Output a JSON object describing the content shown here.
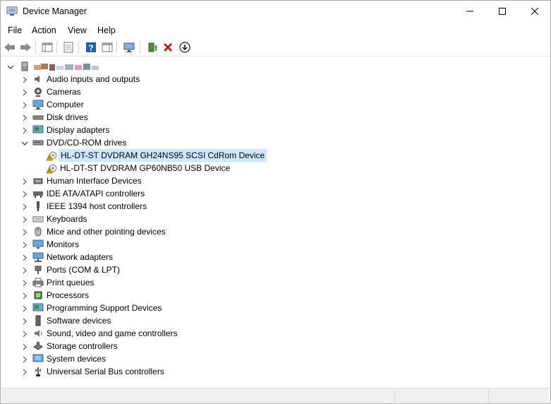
{
  "window": {
    "title": "Device Manager"
  },
  "menu": {
    "file": "File",
    "action": "Action",
    "view": "View",
    "help": "Help"
  },
  "toolbar": {
    "icons": [
      "back-arrow-icon",
      "forward-arrow-icon",
      "properties-pane-icon",
      "show-hide-tree-icon",
      "help-icon",
      "action-pane-icon",
      "scan-hardware-icon",
      "update-driver-icon",
      "uninstall-device-icon",
      "disable-device-icon"
    ],
    "colors": {
      "uninstall_red": "#d40000",
      "help_blue": "#1f5fb4"
    }
  },
  "tree": {
    "root_label": "",
    "categories": [
      {
        "label": "Audio inputs and outputs",
        "icon": "speaker-icon",
        "expanded": false
      },
      {
        "label": "Cameras",
        "icon": "camera-icon",
        "expanded": false
      },
      {
        "label": "Computer",
        "icon": "computer-icon",
        "expanded": false
      },
      {
        "label": "Disk drives",
        "icon": "disk-drive-icon",
        "expanded": false
      },
      {
        "label": "Display adapters",
        "icon": "display-adapter-icon",
        "expanded": false
      },
      {
        "label": "DVD/CD-ROM drives",
        "icon": "dvd-drive-icon",
        "expanded": true,
        "children": [
          {
            "label": "HL-DT-ST DVDRAM GH24NS95 SCSI CdRom Device",
            "icon": "warning-dvd-icon",
            "selected": true
          },
          {
            "label": "HL-DT-ST DVDRAM GP60NB50 USB Device",
            "icon": "warning-dvd-icon",
            "selected": false
          }
        ]
      },
      {
        "label": "Human Interface Devices",
        "icon": "hid-icon",
        "expanded": false
      },
      {
        "label": "IDE ATA/ATAPI controllers",
        "icon": "ide-controller-icon",
        "expanded": false
      },
      {
        "label": "IEEE 1394 host controllers",
        "icon": "firewire-icon",
        "expanded": false
      },
      {
        "label": "Keyboards",
        "icon": "keyboard-icon",
        "expanded": false
      },
      {
        "label": "Mice and other pointing devices",
        "icon": "mouse-icon",
        "expanded": false
      },
      {
        "label": "Monitors",
        "icon": "monitor-icon",
        "expanded": false
      },
      {
        "label": "Network adapters",
        "icon": "network-adapter-icon",
        "expanded": false
      },
      {
        "label": "Ports (COM & LPT)",
        "icon": "port-icon",
        "expanded": false
      },
      {
        "label": "Print queues",
        "icon": "printer-icon",
        "expanded": false
      },
      {
        "label": "Processors",
        "icon": "processor-icon",
        "expanded": false
      },
      {
        "label": "Programming Support Devices",
        "icon": "programming-device-icon",
        "expanded": false
      },
      {
        "label": "Software devices",
        "icon": "software-device-icon",
        "expanded": false
      },
      {
        "label": "Sound, video and game controllers",
        "icon": "sound-icon",
        "expanded": false
      },
      {
        "label": "Storage controllers",
        "icon": "storage-controller-icon",
        "expanded": false
      },
      {
        "label": "System devices",
        "icon": "system-device-icon",
        "expanded": false
      },
      {
        "label": "Universal Serial Bus controllers",
        "icon": "usb-icon",
        "expanded": false
      }
    ]
  },
  "colors": {
    "selection": "#cce8ff",
    "statusbar": "#f0f0f0",
    "warning": "#f2c200"
  }
}
